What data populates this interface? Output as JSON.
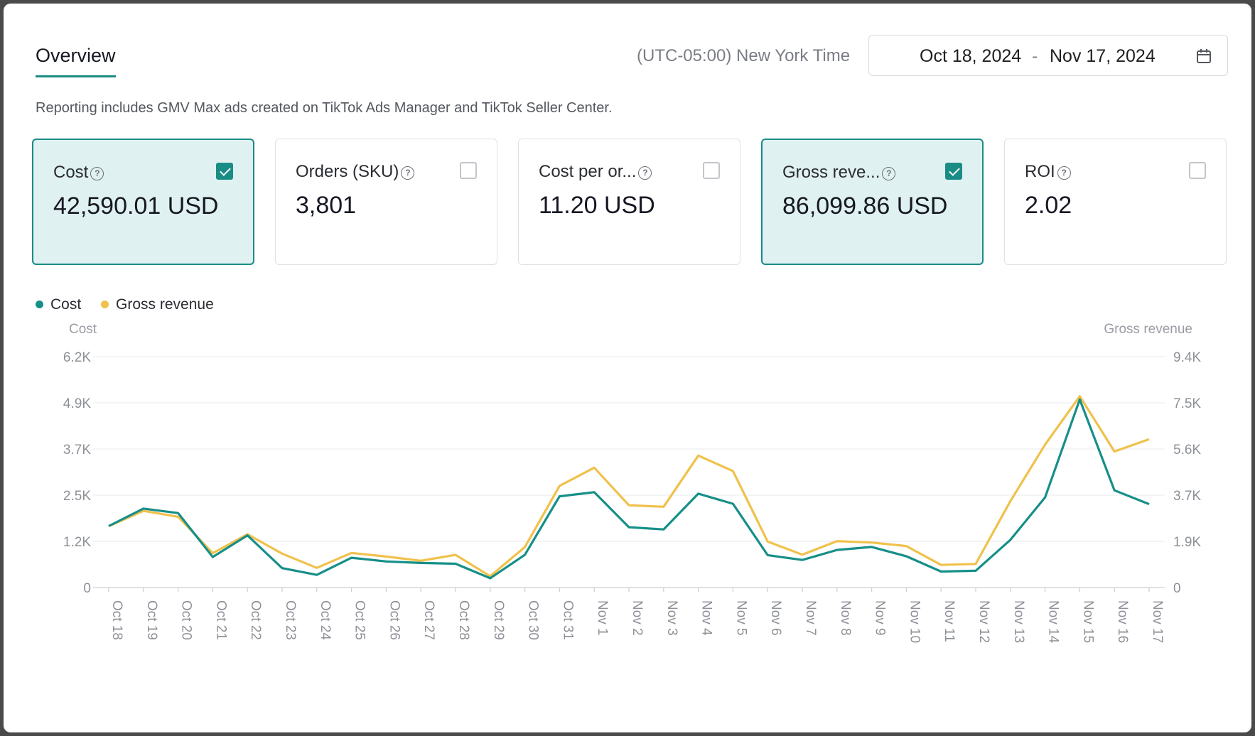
{
  "header": {
    "tab_label": "Overview",
    "timezone": "(UTC-05:00) New York Time",
    "date_start": "Oct 18, 2024",
    "date_separator": "-",
    "date_end": "Nov 17, 2024",
    "calendar_icon": "calendar-icon"
  },
  "note": "Reporting includes GMV Max ads created on TikTok Ads Manager and TikTok Seller Center.",
  "colors": {
    "accent": "#1a8c86",
    "cost": "#168f88",
    "revenue": "#f0c14b"
  },
  "metrics": [
    {
      "label": "Cost",
      "value": "42,590.01 USD",
      "checked": true
    },
    {
      "label": "Orders (SKU)",
      "value": "3,801",
      "checked": false
    },
    {
      "label": "Cost per or...",
      "value": "11.20 USD",
      "checked": false
    },
    {
      "label": "Gross reve...",
      "value": "86,099.86 USD",
      "checked": true
    },
    {
      "label": "ROI",
      "value": "2.02",
      "checked": false
    }
  ],
  "help_icon": "?",
  "chart_data": {
    "type": "line",
    "legend": [
      "Cost",
      "Gross revenue"
    ],
    "legend_position": "top-left",
    "y_left_label": "Cost",
    "y_right_label": "Gross revenue",
    "y_left_ticks": [
      "0",
      "1.2K",
      "2.5K",
      "3.7K",
      "4.9K",
      "6.2K"
    ],
    "y_right_ticks": [
      "0",
      "1.9K",
      "3.7K",
      "5.6K",
      "7.5K",
      "9.4K"
    ],
    "y_left_range": [
      0,
      6200
    ],
    "y_right_range": [
      0,
      9400
    ],
    "grid": true,
    "categories": [
      "Oct 18",
      "Oct 19",
      "Oct 20",
      "Oct 21",
      "Oct 22",
      "Oct 23",
      "Oct 24",
      "Oct 25",
      "Oct 26",
      "Oct 27",
      "Oct 28",
      "Oct 29",
      "Oct 30",
      "Oct 31",
      "Nov 1",
      "Nov 2",
      "Nov 3",
      "Nov 4",
      "Nov 5",
      "Nov 6",
      "Nov 7",
      "Nov 8",
      "Nov 9",
      "Nov 10",
      "Nov 11",
      "Nov 12",
      "Nov 13",
      "Nov 14",
      "Nov 15",
      "Nov 16",
      "Nov 17"
    ],
    "series": [
      {
        "name": "Cost",
        "axis": "left",
        "values": [
          1650,
          2120,
          2000,
          820,
          1400,
          520,
          340,
          800,
          700,
          660,
          640,
          250,
          880,
          2450,
          2560,
          1620,
          1560,
          2520,
          2250,
          870,
          740,
          1010,
          1090,
          840,
          430,
          450,
          1280,
          2420,
          5050,
          2610,
          2240
        ]
      },
      {
        "name": "Gross revenue",
        "axis": "right",
        "values": [
          2500,
          3120,
          2880,
          1400,
          2170,
          1380,
          800,
          1410,
          1260,
          1090,
          1330,
          460,
          1650,
          4140,
          4880,
          3350,
          3290,
          5370,
          4740,
          1870,
          1340,
          1890,
          1830,
          1690,
          920,
          960,
          3520,
          5820,
          7790,
          5540,
          6040
        ]
      }
    ]
  }
}
